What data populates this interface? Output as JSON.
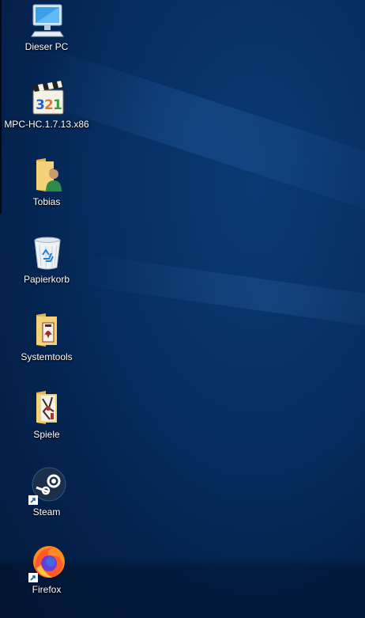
{
  "desktop": {
    "icons": [
      {
        "label": "Dieser PC",
        "icon": "computer-icon"
      },
      {
        "label": "MPC-HC.1.7.13.x86",
        "icon": "media-player-icon"
      },
      {
        "label": "Tobias",
        "icon": "user-folder-icon"
      },
      {
        "label": "Papierkorb",
        "icon": "recycle-bin-icon"
      },
      {
        "label": "Systemtools",
        "icon": "folder-icon"
      },
      {
        "label": "Spiele",
        "icon": "folder-icon"
      },
      {
        "label": "Steam",
        "icon": "steam-icon"
      },
      {
        "label": "Firefox",
        "icon": "firefox-icon"
      }
    ]
  },
  "colors": {
    "wallpaper": "#073064",
    "label_text": "#ffffff"
  }
}
